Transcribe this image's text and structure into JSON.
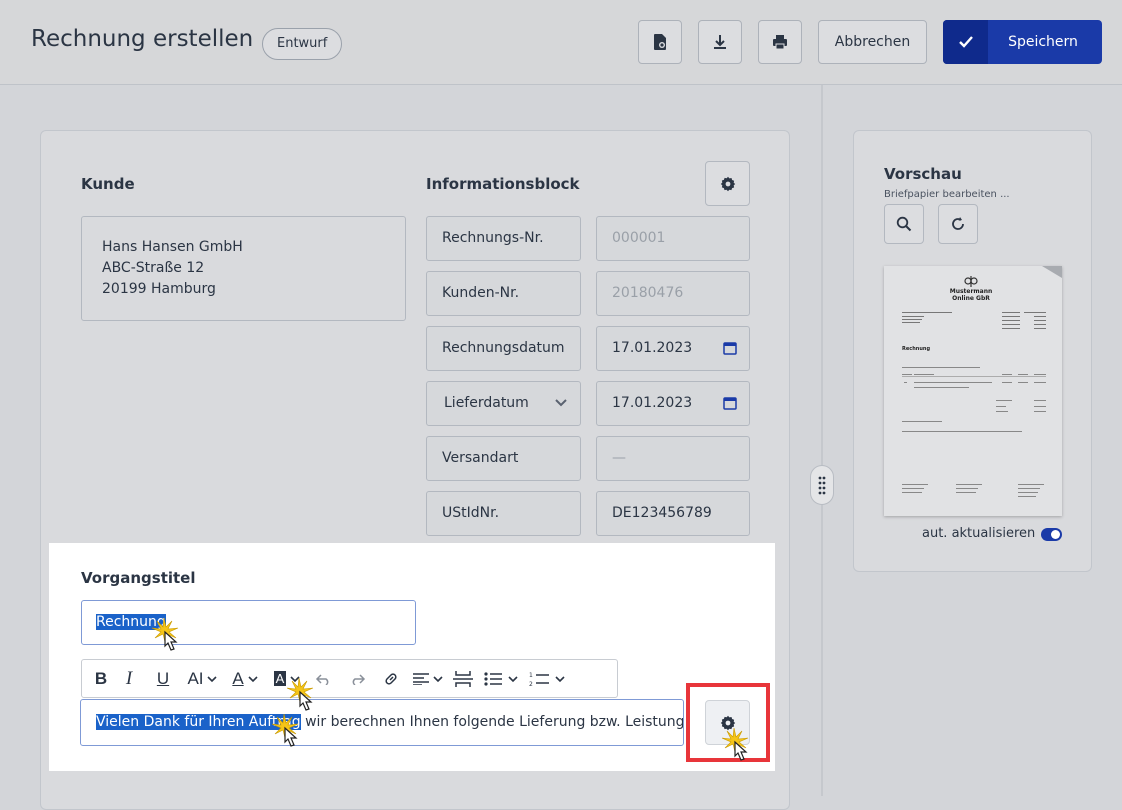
{
  "header": {
    "title": "Rechnung erstellen",
    "status_badge": "Entwurf",
    "cancel_label": "Abbrechen",
    "save_label": "Speichern",
    "icons": [
      "document-preview-icon",
      "download-icon",
      "printer-icon",
      "check-icon"
    ]
  },
  "customer": {
    "label": "Kunde",
    "address_lines": [
      "Hans Hansen GmbH",
      "ABC-Straße 12",
      "20199 Hamburg"
    ]
  },
  "info_block": {
    "label": "Informationsblock",
    "rows": [
      {
        "label": "Rechnungs-Nr.",
        "value": "000001"
      },
      {
        "label": "Kunden-Nr.",
        "value": "20180476"
      },
      {
        "label": "Rechnungsdatum",
        "value": "17.01.2023"
      },
      {
        "label": "Lieferdatum",
        "value": "17.01.2023"
      },
      {
        "label": "Versandart",
        "value": "—"
      },
      {
        "label": "UStIdNr.",
        "value": "DE123456789"
      }
    ]
  },
  "preview": {
    "title": "Vorschau",
    "subtitle": "Briefpapier bearbeiten ...",
    "auto_update_label": "aut. aktualisieren",
    "auto_update_on": true,
    "paper": {
      "company_name_line1": "Mustermann",
      "company_name_line2": "Online GbR",
      "doc_title": "Rechnung"
    }
  },
  "editor": {
    "label": "Vorgangstitel",
    "title_value": "Rechnung",
    "body_selected": "Vielen Dank für Ihren Auftrag",
    "body_rest": "wir berechnen Ihnen folgende Lieferung bzw. Leistung:",
    "toolbar": [
      "bold-icon",
      "italic-icon",
      "underline-icon",
      "font-size-icon",
      "text-color-icon",
      "highlight-color-icon",
      "undo-icon",
      "redo-icon",
      "link-icon",
      "align-icon",
      "page-break-icon",
      "bullet-list-icon",
      "numbered-list-icon"
    ]
  },
  "colors": {
    "accent": "#1a3aa8",
    "selection": "#1a62c9",
    "highlight_border": "#e8353a"
  }
}
